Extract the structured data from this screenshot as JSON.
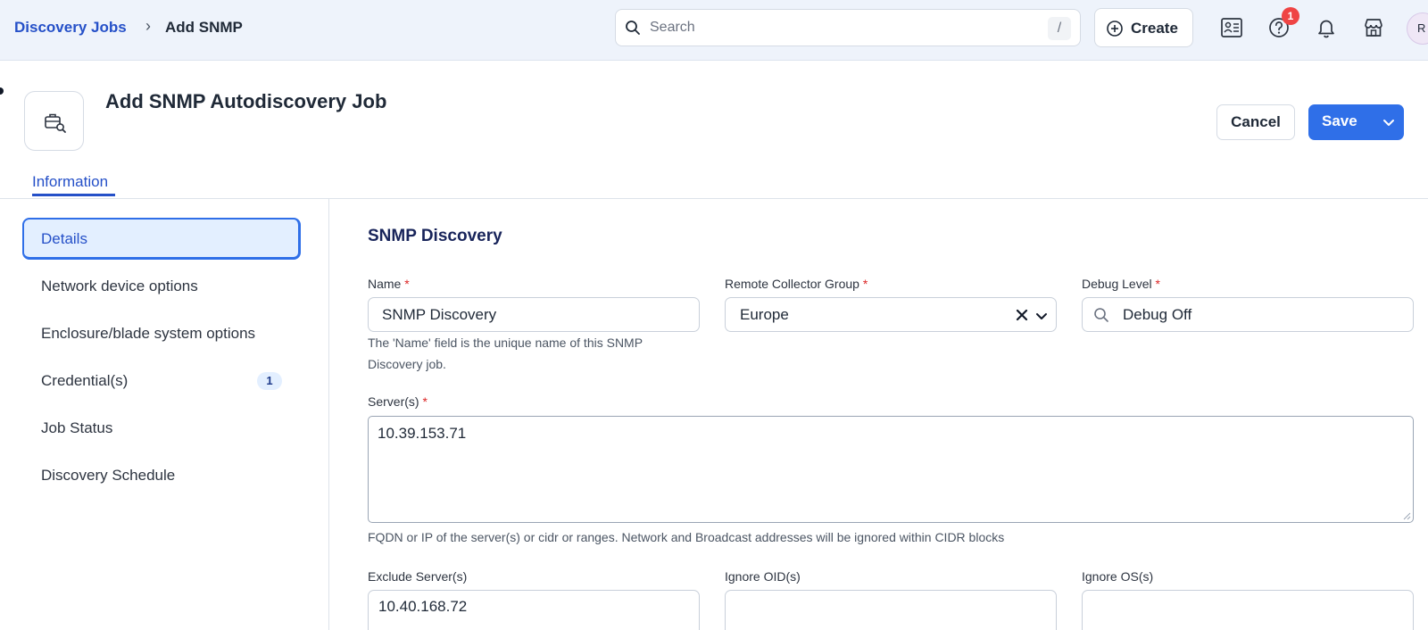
{
  "breadcrumb": {
    "parent": "Discovery Jobs",
    "separator": "›",
    "current": "Add SNMP"
  },
  "search": {
    "placeholder": "Search",
    "shortcut": "/"
  },
  "toolbar": {
    "create_label": "Create",
    "help_badge_count": "1",
    "avatar_initial": "R",
    "icons": [
      "contact-card-icon",
      "help-icon",
      "bell-icon",
      "store-icon"
    ]
  },
  "page": {
    "title": "Add SNMP Autodiscovery Job",
    "icon": "briefcase-search-icon",
    "cancel_label": "Cancel",
    "save_label": "Save",
    "tab": "Information"
  },
  "sidebar": {
    "items": [
      {
        "label": "Details",
        "active": true
      },
      {
        "label": "Network device options"
      },
      {
        "label": "Enclosure/blade system options"
      },
      {
        "label": "Credential(s)",
        "count": "1"
      },
      {
        "label": "Job Status"
      },
      {
        "label": "Discovery Schedule"
      }
    ]
  },
  "form": {
    "section_title": "SNMP Discovery",
    "required_marker": "*",
    "name": {
      "label": "Name",
      "value": "SNMP Discovery",
      "help_line1": "The 'Name' field is the unique name of this SNMP",
      "help_line2": "Discovery job."
    },
    "collector_group": {
      "label": "Remote Collector Group",
      "value": "Europe"
    },
    "debug_level": {
      "label": "Debug Level",
      "value": "Debug Off"
    },
    "servers": {
      "label": "Server(s)",
      "value": "10.39.153.71",
      "help": "FQDN or IP of the server(s) or cidr or ranges. Network and Broadcast addresses will be ignored within CIDR blocks"
    },
    "exclude_servers": {
      "label": "Exclude Server(s)",
      "value": "10.40.168.72"
    },
    "ignore_oids": {
      "label": "Ignore OID(s)",
      "value": ""
    },
    "ignore_os": {
      "label": "Ignore OS(s)",
      "value": ""
    }
  },
  "colors": {
    "accent": "#2f6fe8",
    "link": "#2550c8",
    "required": "#dc2626",
    "badge": "#ef4444",
    "topbar_bg": "#eef3fb"
  }
}
